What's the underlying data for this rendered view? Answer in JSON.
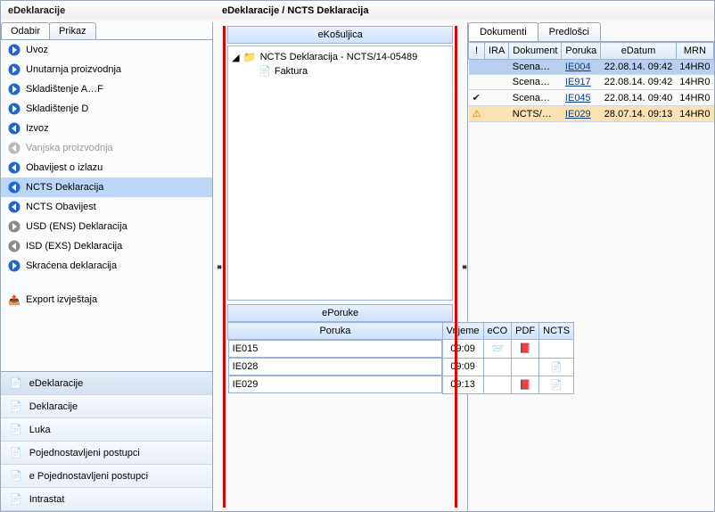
{
  "titles": {
    "left": "eDeklaracije",
    "main": "eDeklaracije / NCTS Deklaracija"
  },
  "leftTabs": {
    "odabir": "Odabir",
    "prikaz": "Prikaz"
  },
  "nav": {
    "items": [
      {
        "label": "Uvoz",
        "color": "#1e66d0",
        "dir": "right"
      },
      {
        "label": "Unutarnja proizvodnja",
        "color": "#1e66d0",
        "dir": "right"
      },
      {
        "label": "Skladištenje A…F",
        "color": "#1e66d0",
        "dir": "right"
      },
      {
        "label": "Skladištenje D",
        "color": "#1e66d0",
        "dir": "right"
      },
      {
        "label": "Izvoz",
        "color": "#1e66d0",
        "dir": "left"
      },
      {
        "label": "Vanjska proizvodnja",
        "disabled": true,
        "color": "#b9b9b9",
        "dir": "left"
      },
      {
        "label": "Obavijest o izlazu",
        "color": "#1e66d0",
        "dir": "left"
      },
      {
        "label": "NCTS Deklaracija",
        "selected": true,
        "color": "#1e66d0",
        "dir": "left"
      },
      {
        "label": "NCTS Obavijest",
        "color": "#1e66d0",
        "dir": "left"
      },
      {
        "label": "USD (ENS) Deklaracija",
        "color": "#8a8a8a",
        "dir": "right"
      },
      {
        "label": "ISD (EXS) Deklaracija",
        "color": "#8a8a8a",
        "dir": "left"
      },
      {
        "label": "Skraćena deklaracija",
        "color": "#1e66d0",
        "dir": "right"
      }
    ],
    "export": "Export izvještaja"
  },
  "bottomNav": [
    {
      "label": "eDeklaracije",
      "selected": true
    },
    {
      "label": "Deklaracije"
    },
    {
      "label": "Luka"
    },
    {
      "label": "Pojednostavljeni postupci"
    },
    {
      "label": "e Pojednostavljeni postupci"
    },
    {
      "label": "Intrastat"
    }
  ],
  "envelope": {
    "title": "eKošuljica",
    "root": "NCTS Deklaracija - NCTS/14-05489",
    "children": [
      {
        "label": "Faktura"
      }
    ]
  },
  "eporuke": {
    "title": "ePoruke",
    "headers": {
      "poruka": "Poruka",
      "vrijeme": "Vrijeme",
      "eco": "eCO",
      "pdf": "PDF",
      "ncts": "NCTS"
    },
    "rows": [
      {
        "poruka": "IE015",
        "vrijeme": "09:09",
        "eco": "envelope",
        "pdf": "pdf",
        "ncts": ""
      },
      {
        "poruka": "IE028",
        "vrijeme": "09:09",
        "eco": "",
        "pdf": "",
        "ncts": "doc"
      },
      {
        "poruka": "IE029",
        "vrijeme": "09:13",
        "eco": "",
        "pdf": "pdf",
        "ncts": "doc"
      }
    ]
  },
  "rightTabs": {
    "dokumenti": "Dokumenti",
    "predlosci": "Predlošci"
  },
  "grid": {
    "headers": {
      "flag": "!",
      "ira": "IRA",
      "dokument": "Dokument",
      "poruka": "Poruka",
      "edatum": "eDatum",
      "mrn": "MRN"
    },
    "rows": [
      {
        "flag": "",
        "ira": "",
        "dokument": "Scena…",
        "poruka": "IE004",
        "edatum": "22.08.14. 09:42",
        "mrn": "14HR0",
        "sel": true
      },
      {
        "flag": "",
        "ira": "",
        "dokument": "Scena…",
        "poruka": "IE917",
        "edatum": "22.08.14. 09:42",
        "mrn": "14HR0"
      },
      {
        "flag": "check",
        "ira": "",
        "dokument": "Scena…",
        "poruka": "IE045",
        "edatum": "22.08.14. 09:40",
        "mrn": "14HR0"
      },
      {
        "flag": "warn",
        "ira": "",
        "dokument": "NCTS/…",
        "poruka": "IE029",
        "edatum": "28.07.14. 09:13",
        "mrn": "14HR0",
        "warn": true
      }
    ]
  }
}
